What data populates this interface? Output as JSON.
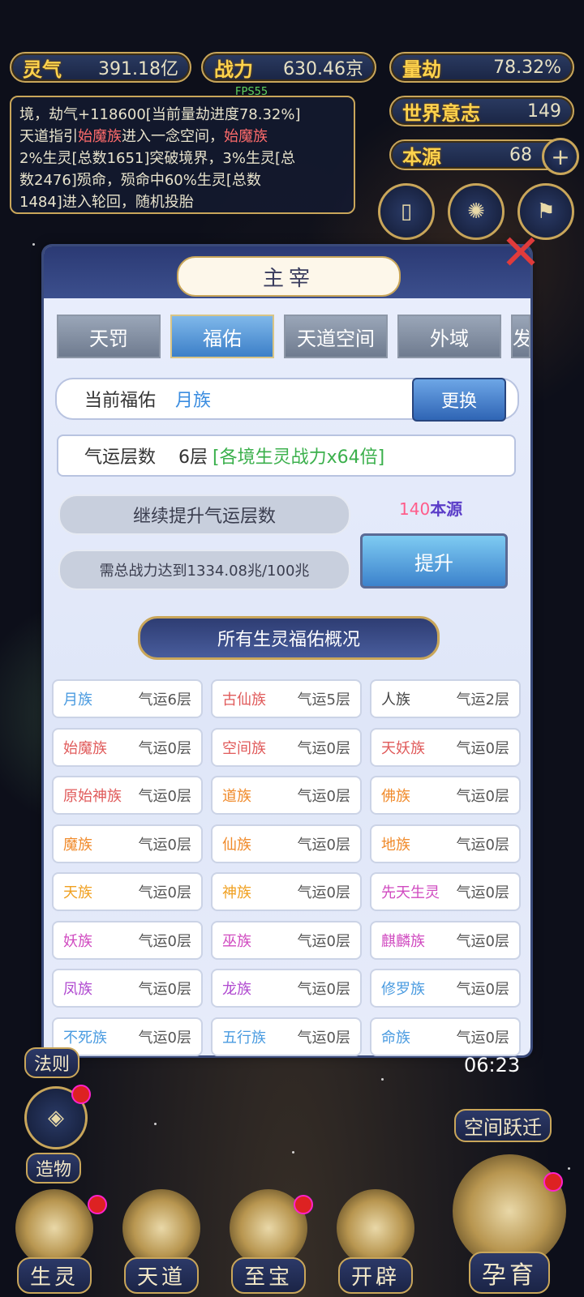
{
  "hud": {
    "lingqi": {
      "label": "灵气",
      "value": "391.18亿"
    },
    "power": {
      "label": "战力",
      "value": "630.46京"
    },
    "liangjie": {
      "label": "量劫",
      "value": "78.32%"
    },
    "world_will": {
      "label": "世界意志",
      "value": "149"
    },
    "origin": {
      "label": "本源",
      "value": "68"
    },
    "fps": "FPS55"
  },
  "log": {
    "line1": "境，劫气+118600[当前量劫进度78.32%]",
    "line2a": "天道指引",
    "line2b": "始魔族",
    "line2c": "进入一念空间，",
    "line2d": "始魔族",
    "line3": "2%生灵[总数1651]突破境界，3%生灵[总",
    "line4": "数2476]殒命，殒命中60%生灵[总数",
    "line5": "1484]进入轮回，随机投胎"
  },
  "panel": {
    "title": "主宰",
    "tabs": [
      {
        "label": "天罚",
        "active": false
      },
      {
        "label": "福佑",
        "active": true
      },
      {
        "label": "天道空间",
        "active": false
      },
      {
        "label": "外域",
        "active": false
      }
    ],
    "tab_overflow": "发",
    "current_blessing_label": "当前福佑",
    "current_blessing_value": "月族",
    "change_button": "更换",
    "luck_layers_label": "气运层数",
    "luck_layers_value": "6层",
    "luck_layers_bonus": "[各境生灵战力x64倍]",
    "continue_label": "继续提升气运层数",
    "requirement": "需总战力达到1334.08兆/100兆",
    "cost_value": "140",
    "cost_unit": "本源",
    "upgrade_button": "提升",
    "overview_title": "所有生灵福佑概况",
    "races": [
      {
        "name": "月族",
        "luck": "气运6层",
        "color": "#4a9be0"
      },
      {
        "name": "古仙族",
        "luck": "气运5层",
        "color": "#e05a5a"
      },
      {
        "name": "人族",
        "luck": "气运2层",
        "color": "#444444"
      },
      {
        "name": "始魔族",
        "luck": "气运0层",
        "color": "#e05a5a"
      },
      {
        "name": "空间族",
        "luck": "气运0层",
        "color": "#e05a5a"
      },
      {
        "name": "天妖族",
        "luck": "气运0层",
        "color": "#e05a5a"
      },
      {
        "name": "原始神族",
        "luck": "气运0层",
        "color": "#e05a5a"
      },
      {
        "name": "道族",
        "luck": "气运0层",
        "color": "#f08a2a"
      },
      {
        "name": "佛族",
        "luck": "气运0层",
        "color": "#f08a2a"
      },
      {
        "name": "魔族",
        "luck": "气运0层",
        "color": "#f08a2a"
      },
      {
        "name": "仙族",
        "luck": "气运0层",
        "color": "#f08a2a"
      },
      {
        "name": "地族",
        "luck": "气运0层",
        "color": "#f08a2a"
      },
      {
        "name": "天族",
        "luck": "气运0层",
        "color": "#f0a020"
      },
      {
        "name": "神族",
        "luck": "气运0层",
        "color": "#f0a020"
      },
      {
        "name": "先天生灵",
        "luck": "气运0层",
        "color": "#d04ac0"
      },
      {
        "name": "妖族",
        "luck": "气运0层",
        "color": "#d04ac0"
      },
      {
        "name": "巫族",
        "luck": "气运0层",
        "color": "#d04ac0"
      },
      {
        "name": "麒麟族",
        "luck": "气运0层",
        "color": "#d04ac0"
      },
      {
        "name": "凤族",
        "luck": "气运0层",
        "color": "#b04ad0"
      },
      {
        "name": "龙族",
        "luck": "气运0层",
        "color": "#b04ad0"
      },
      {
        "name": "修罗族",
        "luck": "气运0层",
        "color": "#4a9be0"
      },
      {
        "name": "不死族",
        "luck": "气运0层",
        "color": "#4a9be0"
      },
      {
        "name": "五行族",
        "luck": "气运0层",
        "color": "#4a9be0"
      },
      {
        "name": "命族",
        "luck": "气运0层",
        "color": "#4a9be0"
      }
    ]
  },
  "side": {
    "law": "法则",
    "creation": "造物",
    "timer": "06:23",
    "space_jump": "空间跃迁"
  },
  "bottom_nav": [
    "生灵",
    "天道",
    "至宝",
    "开辟",
    "孕育"
  ]
}
